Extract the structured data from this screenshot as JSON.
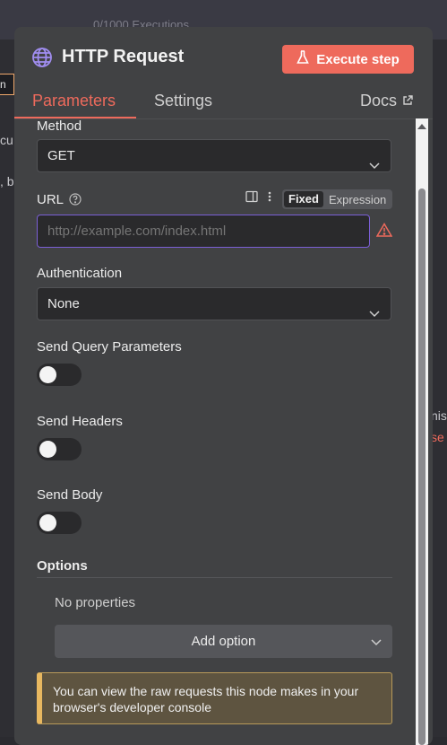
{
  "background": {
    "executions": "0/1000 Executions",
    "left_tab": "n",
    "left_frag_1": "cu",
    "left_frag_2": ", b",
    "right_frag_1": "nis",
    "right_frag_2": "se"
  },
  "header": {
    "title": "HTTP Request",
    "node_icon": "globe-icon",
    "execute_label": "Execute step",
    "execute_icon": "flask-icon"
  },
  "tabs": [
    {
      "label": "Parameters",
      "active": true
    },
    {
      "label": "Settings",
      "active": false
    }
  ],
  "docs_label": "Docs",
  "fields": {
    "method": {
      "label": "Method",
      "value": "GET"
    },
    "url": {
      "label": "URL",
      "placeholder": "http://example.com/index.html",
      "mode_fixed": "Fixed",
      "mode_expression": "Expression"
    },
    "authentication": {
      "label": "Authentication",
      "value": "None"
    },
    "send_query": {
      "label": "Send Query Parameters",
      "enabled": false
    },
    "send_headers": {
      "label": "Send Headers",
      "enabled": false
    },
    "send_body": {
      "label": "Send Body",
      "enabled": false
    }
  },
  "options": {
    "label": "Options",
    "empty_text": "No properties",
    "add_label": "Add option"
  },
  "notice": "You can view the raw requests this node makes in your browser's developer console",
  "colors": {
    "accent": "#ee6a5c",
    "focus_border": "#7b5fd6",
    "warning": "#ee6a5c",
    "notice_bar": "#e8b860"
  }
}
